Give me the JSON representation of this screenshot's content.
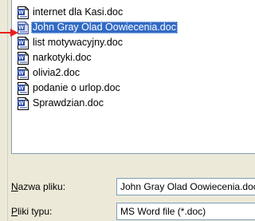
{
  "files": [
    {
      "name": "internet dla Kasi.doc",
      "icon": "word-doc-icon",
      "selected": false
    },
    {
      "name": "John Gray  Olad Oowiecenia.doc",
      "icon": "word-doc-icon",
      "selected": true
    },
    {
      "name": "list motywacyjny.doc",
      "icon": "word-doc-icon",
      "selected": false
    },
    {
      "name": "narkotyki.doc",
      "icon": "word-doc-icon",
      "selected": false
    },
    {
      "name": "olivia2.doc",
      "icon": "word-doc-icon",
      "selected": false
    },
    {
      "name": "podanie o urlop.doc",
      "icon": "word-doc-icon",
      "selected": false
    },
    {
      "name": "Sprawdzian.doc",
      "icon": "word-doc-icon",
      "selected": false
    }
  ],
  "form": {
    "file_name_label_mnemonic": "N",
    "file_name_label_rest": "azwa pliku:",
    "file_name_value": "John Gray  Olad Oowiecenia.doc",
    "file_type_label_mnemonic": "P",
    "file_type_label_rest": "liki typu:",
    "file_type_value": "MS Word file (*.doc)"
  },
  "colors": {
    "selection": "#316ac5",
    "pointer_arrow": "#e8201c",
    "dialog_background": "#ece9d8",
    "field_border": "#7f9db9"
  }
}
